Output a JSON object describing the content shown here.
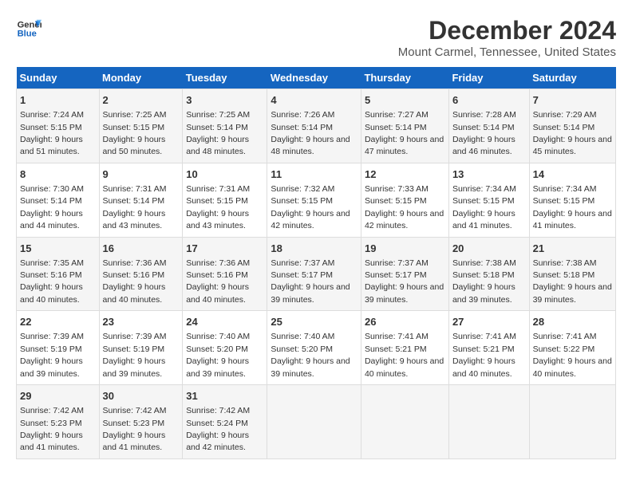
{
  "logo": {
    "line1": "General",
    "line2": "Blue"
  },
  "title": "December 2024",
  "subtitle": "Mount Carmel, Tennessee, United States",
  "days_of_week": [
    "Sunday",
    "Monday",
    "Tuesday",
    "Wednesday",
    "Thursday",
    "Friday",
    "Saturday"
  ],
  "weeks": [
    [
      {
        "day": "1",
        "sunrise": "7:24 AM",
        "sunset": "5:15 PM",
        "daylight": "9 hours and 51 minutes."
      },
      {
        "day": "2",
        "sunrise": "7:25 AM",
        "sunset": "5:15 PM",
        "daylight": "9 hours and 50 minutes."
      },
      {
        "day": "3",
        "sunrise": "7:25 AM",
        "sunset": "5:14 PM",
        "daylight": "9 hours and 48 minutes."
      },
      {
        "day": "4",
        "sunrise": "7:26 AM",
        "sunset": "5:14 PM",
        "daylight": "9 hours and 48 minutes."
      },
      {
        "day": "5",
        "sunrise": "7:27 AM",
        "sunset": "5:14 PM",
        "daylight": "9 hours and 47 minutes."
      },
      {
        "day": "6",
        "sunrise": "7:28 AM",
        "sunset": "5:14 PM",
        "daylight": "9 hours and 46 minutes."
      },
      {
        "day": "7",
        "sunrise": "7:29 AM",
        "sunset": "5:14 PM",
        "daylight": "9 hours and 45 minutes."
      }
    ],
    [
      {
        "day": "8",
        "sunrise": "7:30 AM",
        "sunset": "5:14 PM",
        "daylight": "9 hours and 44 minutes."
      },
      {
        "day": "9",
        "sunrise": "7:31 AM",
        "sunset": "5:14 PM",
        "daylight": "9 hours and 43 minutes."
      },
      {
        "day": "10",
        "sunrise": "7:31 AM",
        "sunset": "5:15 PM",
        "daylight": "9 hours and 43 minutes."
      },
      {
        "day": "11",
        "sunrise": "7:32 AM",
        "sunset": "5:15 PM",
        "daylight": "9 hours and 42 minutes."
      },
      {
        "day": "12",
        "sunrise": "7:33 AM",
        "sunset": "5:15 PM",
        "daylight": "9 hours and 42 minutes."
      },
      {
        "day": "13",
        "sunrise": "7:34 AM",
        "sunset": "5:15 PM",
        "daylight": "9 hours and 41 minutes."
      },
      {
        "day": "14",
        "sunrise": "7:34 AM",
        "sunset": "5:15 PM",
        "daylight": "9 hours and 41 minutes."
      }
    ],
    [
      {
        "day": "15",
        "sunrise": "7:35 AM",
        "sunset": "5:16 PM",
        "daylight": "9 hours and 40 minutes."
      },
      {
        "day": "16",
        "sunrise": "7:36 AM",
        "sunset": "5:16 PM",
        "daylight": "9 hours and 40 minutes."
      },
      {
        "day": "17",
        "sunrise": "7:36 AM",
        "sunset": "5:16 PM",
        "daylight": "9 hours and 40 minutes."
      },
      {
        "day": "18",
        "sunrise": "7:37 AM",
        "sunset": "5:17 PM",
        "daylight": "9 hours and 39 minutes."
      },
      {
        "day": "19",
        "sunrise": "7:37 AM",
        "sunset": "5:17 PM",
        "daylight": "9 hours and 39 minutes."
      },
      {
        "day": "20",
        "sunrise": "7:38 AM",
        "sunset": "5:18 PM",
        "daylight": "9 hours and 39 minutes."
      },
      {
        "day": "21",
        "sunrise": "7:38 AM",
        "sunset": "5:18 PM",
        "daylight": "9 hours and 39 minutes."
      }
    ],
    [
      {
        "day": "22",
        "sunrise": "7:39 AM",
        "sunset": "5:19 PM",
        "daylight": "9 hours and 39 minutes."
      },
      {
        "day": "23",
        "sunrise": "7:39 AM",
        "sunset": "5:19 PM",
        "daylight": "9 hours and 39 minutes."
      },
      {
        "day": "24",
        "sunrise": "7:40 AM",
        "sunset": "5:20 PM",
        "daylight": "9 hours and 39 minutes."
      },
      {
        "day": "25",
        "sunrise": "7:40 AM",
        "sunset": "5:20 PM",
        "daylight": "9 hours and 39 minutes."
      },
      {
        "day": "26",
        "sunrise": "7:41 AM",
        "sunset": "5:21 PM",
        "daylight": "9 hours and 40 minutes."
      },
      {
        "day": "27",
        "sunrise": "7:41 AM",
        "sunset": "5:21 PM",
        "daylight": "9 hours and 40 minutes."
      },
      {
        "day": "28",
        "sunrise": "7:41 AM",
        "sunset": "5:22 PM",
        "daylight": "9 hours and 40 minutes."
      }
    ],
    [
      {
        "day": "29",
        "sunrise": "7:42 AM",
        "sunset": "5:23 PM",
        "daylight": "9 hours and 41 minutes."
      },
      {
        "day": "30",
        "sunrise": "7:42 AM",
        "sunset": "5:23 PM",
        "daylight": "9 hours and 41 minutes."
      },
      {
        "day": "31",
        "sunrise": "7:42 AM",
        "sunset": "5:24 PM",
        "daylight": "9 hours and 42 minutes."
      },
      null,
      null,
      null,
      null
    ]
  ],
  "labels": {
    "sunrise": "Sunrise:",
    "sunset": "Sunset:",
    "daylight": "Daylight:"
  }
}
